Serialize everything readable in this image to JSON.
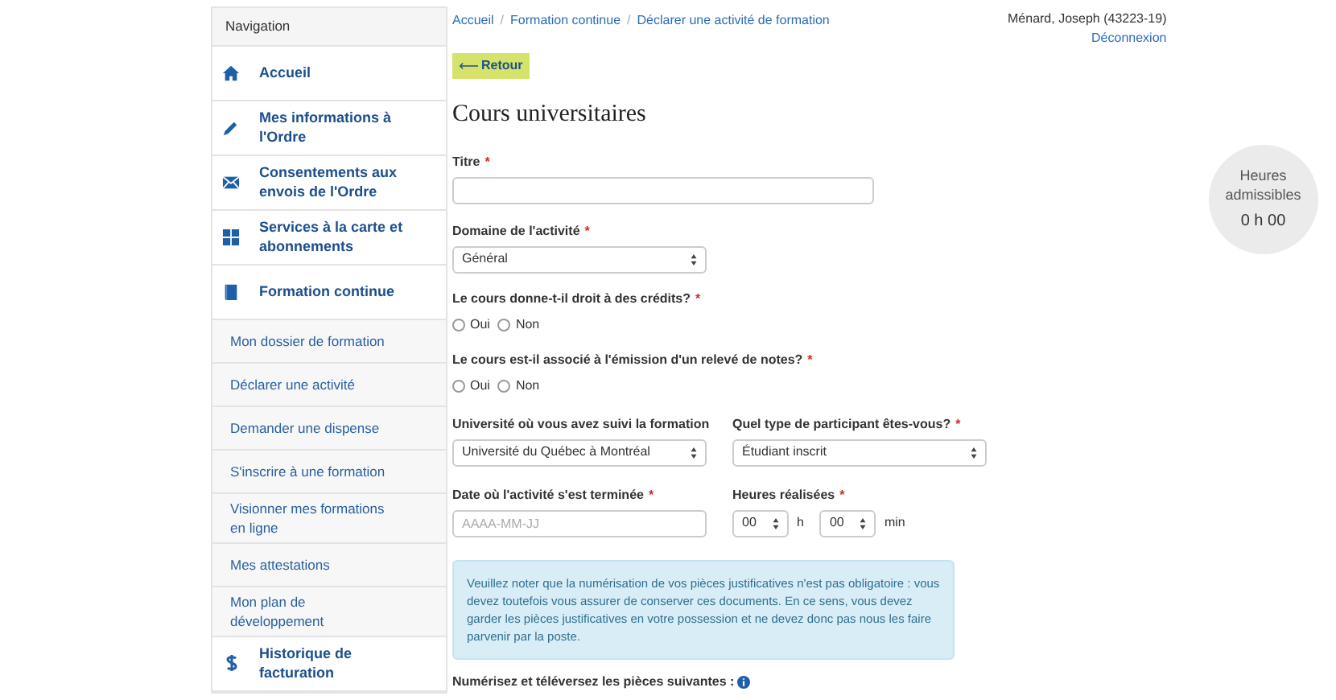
{
  "sidebar": {
    "title": "Navigation",
    "items": [
      {
        "kind": "main",
        "label": "Accueil"
      },
      {
        "kind": "main",
        "label": "Mes informations à l'Ordre"
      },
      {
        "kind": "main",
        "label": "Consentements aux envois de l'Ordre"
      },
      {
        "kind": "main",
        "label": "Services à la carte et abonnements"
      },
      {
        "kind": "main",
        "label": "Formation continue"
      },
      {
        "kind": "sub",
        "label": "Mon dossier de formation"
      },
      {
        "kind": "sub",
        "label": "Déclarer une activité"
      },
      {
        "kind": "sub",
        "label": "Demander une dispense"
      },
      {
        "kind": "sub",
        "label": "S'inscrire à une formation"
      },
      {
        "kind": "sub",
        "label": "Visionner mes formations en ligne"
      },
      {
        "kind": "sub",
        "label": "Mes attestations"
      },
      {
        "kind": "sub",
        "label": "Mon plan de développement"
      },
      {
        "kind": "main",
        "label": "Historique de facturation"
      }
    ]
  },
  "breadcrumb": [
    {
      "label": "Accueil",
      "separator": "/"
    },
    {
      "label": "Formation continue",
      "separator": "/"
    },
    {
      "label": "Déclarer une activité de formation"
    }
  ],
  "back_button": "Retour",
  "heading": "Cours universitaires",
  "form": {
    "title_field": {
      "label": "Titre",
      "required_mark": "*"
    },
    "domain": {
      "label": "Domaine de l'activité",
      "required_mark": "*",
      "value": "Général"
    },
    "credits_question": {
      "label": "Le cours donne-t-il droit à des crédits?",
      "required_mark": "*",
      "options": [
        {
          "label": "Oui",
          "selected": false
        },
        {
          "label": "Non",
          "selected": false
        }
      ]
    },
    "transcript_question": {
      "label": "Le cours est-il associé à l'émission d'un relevé de notes?",
      "required_mark": "*",
      "options": [
        {
          "label": "Oui",
          "selected": false
        },
        {
          "label": "Non",
          "selected": false
        }
      ]
    },
    "university": {
      "label": "Université où vous avez suivi la formation",
      "value": "Université du Québec à Montréal"
    },
    "participant_type": {
      "label": "Quel type de participant êtes-vous?",
      "required_mark": "*",
      "value": "Étudiant inscrit"
    },
    "end_date": {
      "label": "Date où l'activité s'est terminée",
      "required_mark": "*",
      "placeholder": "AAAA-MM-JJ"
    },
    "hours": {
      "label": "Heures réalisées",
      "required_mark": "*",
      "hours": "00",
      "hours_unit": "h",
      "minutes": "00",
      "minutes_unit": "min"
    },
    "notice": "Veuillez noter que la numérisation de vos pièces justificatives n'est pas obligatoire : vous devez toutefois vous assurer de conserver ces documents. En ce sens, vous devez garder les pièces justificatives en votre possession et ne devez donc pas nous les faire parvenir par la poste.",
    "upload_label": "Numérisez et téléversez les pièces suivantes :"
  },
  "user": {
    "name": "Ménard, Joseph (43223-19)",
    "logout": "Déconnexion"
  },
  "hours_badge": {
    "label": "Heures admissibles",
    "value": "0 h 00"
  }
}
